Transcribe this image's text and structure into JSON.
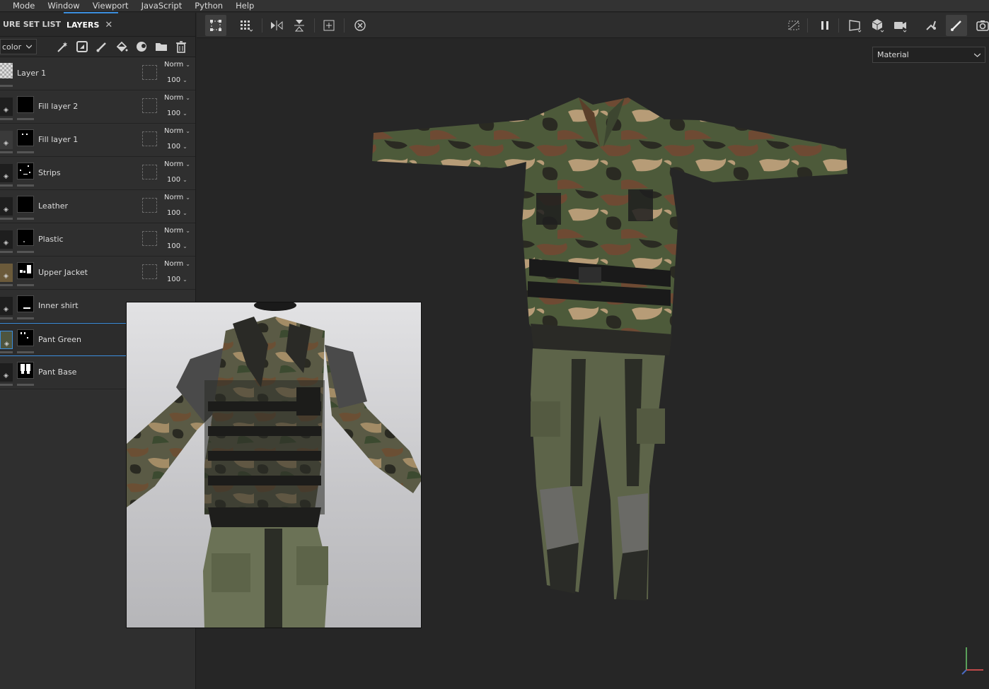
{
  "menubar": {
    "items": [
      "Mode",
      "Window",
      "Viewport",
      "JavaScript",
      "Python",
      "Help"
    ]
  },
  "left_panel": {
    "tabs": [
      {
        "label": "URE SET LIST"
      },
      {
        "label": "LAYERS",
        "close": "✕"
      }
    ],
    "channel_dropdown": "color",
    "layers": [
      {
        "name": "Layer 1",
        "blend": "Norm",
        "opacity": "100"
      },
      {
        "name": "Fill layer 2",
        "blend": "Norm",
        "opacity": "100"
      },
      {
        "name": "Fill layer 1",
        "blend": "Norm",
        "opacity": "100"
      },
      {
        "name": "Strips",
        "blend": "Norm",
        "opacity": "100"
      },
      {
        "name": "Leather",
        "blend": "Norm",
        "opacity": "100"
      },
      {
        "name": "Plastic",
        "blend": "Norm",
        "opacity": "100"
      },
      {
        "name": "Upper Jacket",
        "blend": "Norm",
        "opacity": "100"
      },
      {
        "name": "Inner shirt"
      },
      {
        "name": "Pant Green",
        "selected": true
      },
      {
        "name": "Pant Base"
      }
    ]
  },
  "viewport": {
    "display_dropdown": "Material"
  },
  "colors": {
    "accent": "#3b8ede",
    "panel": "#2f2f2f",
    "viewport_bg": "#262626",
    "camo_brown": "#6e4a33",
    "camo_green": "#4d5a3a",
    "camo_tan": "#b79c77",
    "pants_green": "#5d6449"
  }
}
